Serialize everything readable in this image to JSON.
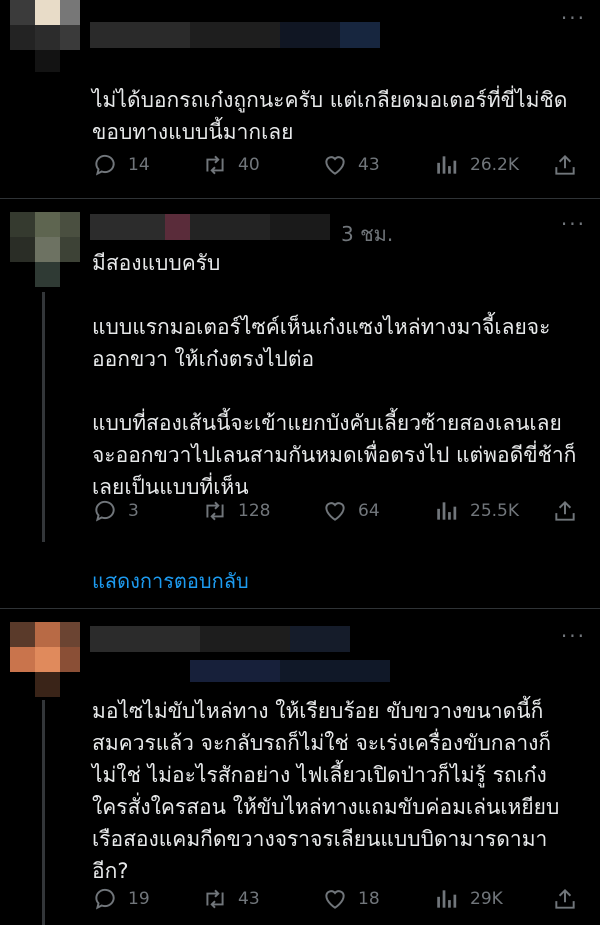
{
  "tweets": [
    {
      "text": "ไม่ได้บอกรถเก๋งถูกนะครับ แต่เกลียดมอเตอร์ที่ขี่ไม่ชิดขอบทางแบบนี้มากเลย",
      "replies": "14",
      "retweets": "40",
      "likes": "43",
      "views": "26.2K"
    },
    {
      "time": "3 ชม.",
      "text": "มีสองแบบครับ\n\nแบบแรกมอเตอร์ไซค์เห็นเก๋งแซงไหล่ทางมาจี้เลยจะออกขวา ให้เก๋งตรงไปต่อ\n\nแบบที่สองเส้นนี้จะเข้าแยกบังคับเลี้ยวซ้ายสองเลนเลยจะออกขวาไปเลนสามกันหมดเพื่อตรงไป แต่พอดีขี่ช้าก็เลยเป็นแบบที่เห็น",
      "replies": "3",
      "retweets": "128",
      "likes": "64",
      "views": "25.5K"
    },
    {
      "text": "มอไซไม่ขับไหล่ทาง ให้เรียบร้อย ขับขวางขนาดนี้ก็สมควรแล้ว จะกลับรถก็ไม่ใช่ จะเร่งเครื่องขับกลางก็ไม่ใช่ ไม่อะไรสักอย่าง ไฟเลี้ยวเปิดป่าวก็ไม่รู้ รถเก๋งใครสั่งใครสอน ให้ขับไหล่ทางแถมขับค่อมเล่นเหยียบเรือสองแคมกีดขวางจราจรเลียนแบบบิดามารดามาอีก?",
      "replies": "19",
      "retweets": "43",
      "likes": "18",
      "views": "29K"
    }
  ],
  "show_replies_label": "แสดงการตอบกลับ",
  "more_label": "···",
  "colors": {
    "background": "#000000",
    "text": "#e7e9ea",
    "muted": "#71767b",
    "link": "#1d9bf0",
    "divider": "#2f3336"
  },
  "icons": [
    "reply-icon",
    "retweet-icon",
    "like-icon",
    "views-icon",
    "share-icon",
    "more-icon"
  ]
}
